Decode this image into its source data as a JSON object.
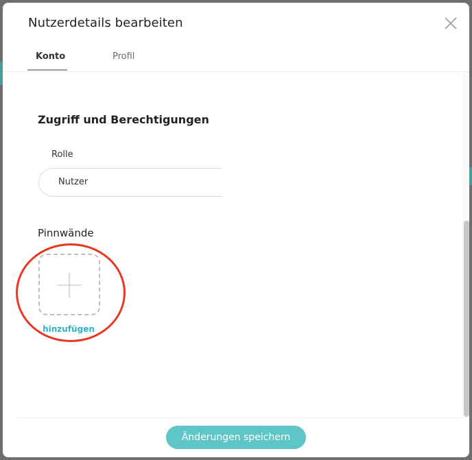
{
  "modal": {
    "title": "Nutzerdetails bearbeiten"
  },
  "tabs": [
    {
      "label": "Konto",
      "active": true
    },
    {
      "label": "Profil",
      "active": false
    }
  ],
  "access": {
    "section_title": "Zugriff und Berechtigungen",
    "role_label": "Rolle",
    "role_value": "Nutzer"
  },
  "boards": {
    "label": "Pinnwände",
    "add_label": "hinzufügen"
  },
  "footer": {
    "save_label": "Änderungen speichern"
  },
  "colors": {
    "accent": "#5fc6c8",
    "link": "#2fb3c9",
    "highlight": "#e8361f"
  },
  "icons": {
    "close": "close-icon",
    "add": "plus-icon"
  }
}
